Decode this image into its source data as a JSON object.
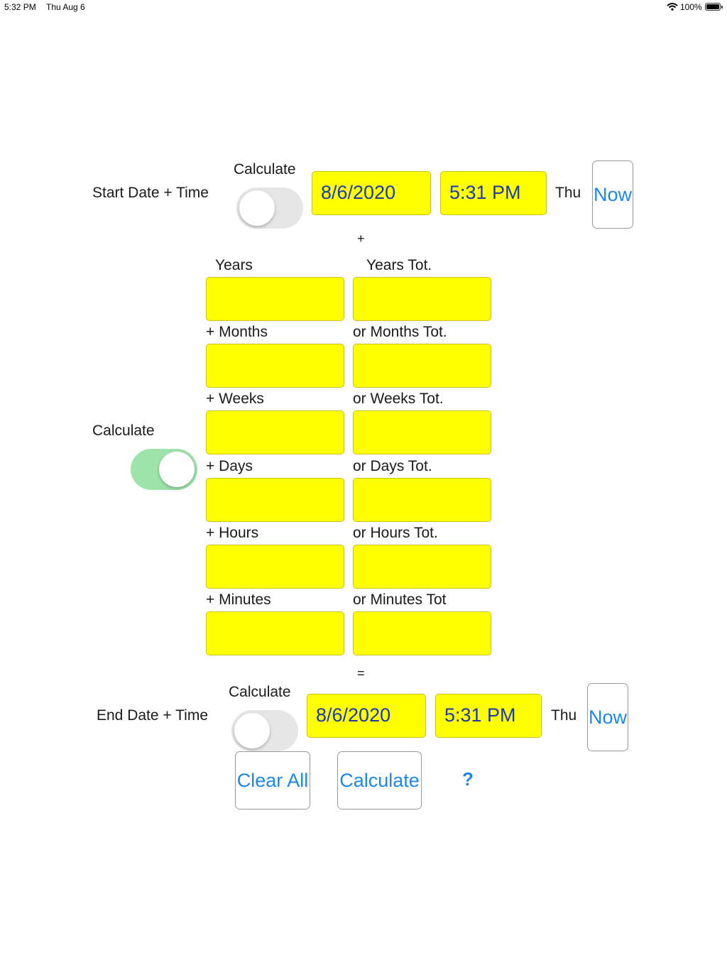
{
  "status_bar": {
    "time": "5:32 PM",
    "date": "Thu Aug 6",
    "battery": "100%",
    "battery_level": 1.0,
    "wifi_icon": "wifi-icon",
    "battery_icon": "battery-icon"
  },
  "start": {
    "label": "Start Date + Time",
    "calc_label": "Calculate",
    "calc_toggle_on": false,
    "date": "8/6/2020",
    "time": "5:31 PM",
    "weekday": "Thu",
    "now_label": "Now"
  },
  "plus_sign": "+",
  "equals_sign": "=",
  "middle": {
    "calc_label": "Calculate",
    "calc_toggle_on": true,
    "rows": [
      {
        "left_label": "Years",
        "right_label": "Years Tot.",
        "left_value": "",
        "right_value": ""
      },
      {
        "left_label": "+ Months",
        "right_label": "or Months Tot.",
        "left_value": "",
        "right_value": ""
      },
      {
        "left_label": "+ Weeks",
        "right_label": "or Weeks Tot.",
        "left_value": "",
        "right_value": ""
      },
      {
        "left_label": "+ Days",
        "right_label": "or Days Tot.",
        "left_value": "",
        "right_value": ""
      },
      {
        "left_label": "+ Hours",
        "right_label": "or Hours Tot.",
        "left_value": "",
        "right_value": ""
      },
      {
        "left_label": "+ Minutes",
        "right_label": "or Minutes Tot",
        "left_value": "",
        "right_value": ""
      }
    ]
  },
  "end": {
    "label": "End Date + Time",
    "calc_label": "Calculate",
    "calc_toggle_on": false,
    "date": "8/6/2020",
    "time": "5:31 PM",
    "weekday": "Thu",
    "now_label": "Now"
  },
  "actions": {
    "clear_all": "Clear All",
    "calculate": "Calculate",
    "help": "?"
  },
  "colors": {
    "field_yellow": "#ffff00",
    "link_blue": "#1a88f0",
    "date_text": "#1b3aa8",
    "toggle_on": "#9ee3aa",
    "toggle_off": "#e6e6e6"
  }
}
